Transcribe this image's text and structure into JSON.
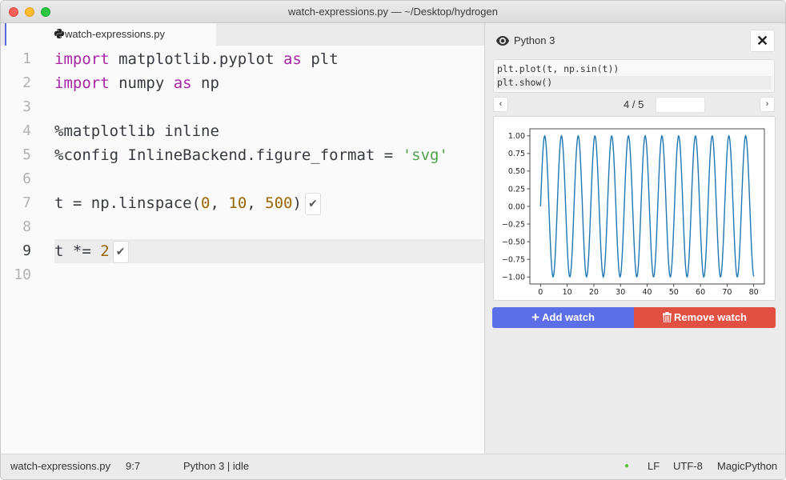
{
  "window": {
    "title": "watch-expressions.py — ~/Desktop/hydrogen"
  },
  "editor": {
    "tab_label": "watch-expressions.py",
    "tab_icon": "python-icon",
    "line_numbers": [
      "1",
      "2",
      "3",
      "4",
      "5",
      "6",
      "7",
      "8",
      "9",
      "10"
    ],
    "active_line": 9,
    "lines": {
      "l1": {
        "kw1": "import",
        "t1": " matplotlib.pyplot ",
        "kw2": "as",
        "t2": " plt"
      },
      "l2": {
        "kw1": "import",
        "t1": " numpy ",
        "kw2": "as",
        "t2": " np"
      },
      "l4": {
        "t1": "%matplotlib inline"
      },
      "l5": {
        "t1": "%config InlineBackend.figure_format = ",
        "str": "'svg'"
      },
      "l7": {
        "t1": "t = np.linspace(",
        "n1": "0",
        "c1": ", ",
        "n2": "10",
        "c2": ", ",
        "n3": "500",
        "t2": ")"
      },
      "l9": {
        "t1": "t *= ",
        "n1": "2"
      }
    },
    "result_check": "✔"
  },
  "watch": {
    "kernel_label": "Python 3",
    "close_label": "✕",
    "expression_lines": [
      "plt.plot(t, np.sin(t))",
      "plt.show()"
    ],
    "prev_label": "‹",
    "next_label": "›",
    "page_indicator": "4 / 5",
    "page_input_value": "",
    "add_label": "Add watch",
    "remove_label": "Remove watch",
    "add_color": "#5c6fe8",
    "remove_color": "#e24f43"
  },
  "chart_data": {
    "type": "line",
    "title": "",
    "xlabel": "",
    "ylabel": "",
    "function": "y = sin(x)",
    "x_range": [
      0,
      80
    ],
    "num_points": 500,
    "xlim": [
      -4,
      84
    ],
    "ylim": [
      -1.1,
      1.1
    ],
    "x_ticks": [
      0,
      10,
      20,
      30,
      40,
      50,
      60,
      70,
      80
    ],
    "y_ticks": [
      -1.0,
      -0.75,
      -0.5,
      -0.25,
      0.0,
      0.25,
      0.5,
      0.75,
      1.0
    ],
    "x_tick_labels": [
      "0",
      "10",
      "20",
      "30",
      "40",
      "50",
      "60",
      "70",
      "80"
    ],
    "y_tick_labels": [
      "−1.00",
      "−0.75",
      "−0.50",
      "−0.25",
      "0.00",
      "0.25",
      "0.50",
      "0.75",
      "1.00"
    ],
    "series": [
      {
        "name": "sin(t)",
        "color": "#1f77b4"
      }
    ],
    "grid": false,
    "legend": "none"
  },
  "status": {
    "file": "watch-expressions.py",
    "cursor": "9:7",
    "kernel_status": "Python 3 | idle",
    "dot": "●",
    "line_ending": "LF",
    "encoding": "UTF-8",
    "grammar": "MagicPython"
  }
}
